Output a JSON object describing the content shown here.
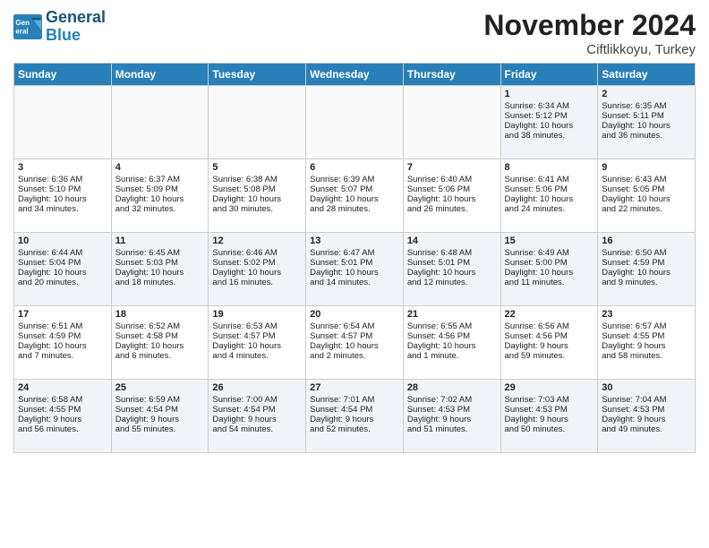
{
  "logo": {
    "line1": "General",
    "line2": "Blue"
  },
  "title": "November 2024",
  "location": "Ciftlikkoyu, Turkey",
  "headers": [
    "Sunday",
    "Monday",
    "Tuesday",
    "Wednesday",
    "Thursday",
    "Friday",
    "Saturday"
  ],
  "weeks": [
    [
      {
        "day": "",
        "content": ""
      },
      {
        "day": "",
        "content": ""
      },
      {
        "day": "",
        "content": ""
      },
      {
        "day": "",
        "content": ""
      },
      {
        "day": "",
        "content": ""
      },
      {
        "day": "1",
        "content": "Sunrise: 6:34 AM\nSunset: 5:12 PM\nDaylight: 10 hours\nand 38 minutes."
      },
      {
        "day": "2",
        "content": "Sunrise: 6:35 AM\nSunset: 5:11 PM\nDaylight: 10 hours\nand 36 minutes."
      }
    ],
    [
      {
        "day": "3",
        "content": "Sunrise: 6:36 AM\nSunset: 5:10 PM\nDaylight: 10 hours\nand 34 minutes."
      },
      {
        "day": "4",
        "content": "Sunrise: 6:37 AM\nSunset: 5:09 PM\nDaylight: 10 hours\nand 32 minutes."
      },
      {
        "day": "5",
        "content": "Sunrise: 6:38 AM\nSunset: 5:08 PM\nDaylight: 10 hours\nand 30 minutes."
      },
      {
        "day": "6",
        "content": "Sunrise: 6:39 AM\nSunset: 5:07 PM\nDaylight: 10 hours\nand 28 minutes."
      },
      {
        "day": "7",
        "content": "Sunrise: 6:40 AM\nSunset: 5:06 PM\nDaylight: 10 hours\nand 26 minutes."
      },
      {
        "day": "8",
        "content": "Sunrise: 6:41 AM\nSunset: 5:06 PM\nDaylight: 10 hours\nand 24 minutes."
      },
      {
        "day": "9",
        "content": "Sunrise: 6:43 AM\nSunset: 5:05 PM\nDaylight: 10 hours\nand 22 minutes."
      }
    ],
    [
      {
        "day": "10",
        "content": "Sunrise: 6:44 AM\nSunset: 5:04 PM\nDaylight: 10 hours\nand 20 minutes."
      },
      {
        "day": "11",
        "content": "Sunrise: 6:45 AM\nSunset: 5:03 PM\nDaylight: 10 hours\nand 18 minutes."
      },
      {
        "day": "12",
        "content": "Sunrise: 6:46 AM\nSunset: 5:02 PM\nDaylight: 10 hours\nand 16 minutes."
      },
      {
        "day": "13",
        "content": "Sunrise: 6:47 AM\nSunset: 5:01 PM\nDaylight: 10 hours\nand 14 minutes."
      },
      {
        "day": "14",
        "content": "Sunrise: 6:48 AM\nSunset: 5:01 PM\nDaylight: 10 hours\nand 12 minutes."
      },
      {
        "day": "15",
        "content": "Sunrise: 6:49 AM\nSunset: 5:00 PM\nDaylight: 10 hours\nand 11 minutes."
      },
      {
        "day": "16",
        "content": "Sunrise: 6:50 AM\nSunset: 4:59 PM\nDaylight: 10 hours\nand 9 minutes."
      }
    ],
    [
      {
        "day": "17",
        "content": "Sunrise: 6:51 AM\nSunset: 4:59 PM\nDaylight: 10 hours\nand 7 minutes."
      },
      {
        "day": "18",
        "content": "Sunrise: 6:52 AM\nSunset: 4:58 PM\nDaylight: 10 hours\nand 6 minutes."
      },
      {
        "day": "19",
        "content": "Sunrise: 6:53 AM\nSunset: 4:57 PM\nDaylight: 10 hours\nand 4 minutes."
      },
      {
        "day": "20",
        "content": "Sunrise: 6:54 AM\nSunset: 4:57 PM\nDaylight: 10 hours\nand 2 minutes."
      },
      {
        "day": "21",
        "content": "Sunrise: 6:55 AM\nSunset: 4:56 PM\nDaylight: 10 hours\nand 1 minute."
      },
      {
        "day": "22",
        "content": "Sunrise: 6:56 AM\nSunset: 4:56 PM\nDaylight: 9 hours\nand 59 minutes."
      },
      {
        "day": "23",
        "content": "Sunrise: 6:57 AM\nSunset: 4:55 PM\nDaylight: 9 hours\nand 58 minutes."
      }
    ],
    [
      {
        "day": "24",
        "content": "Sunrise: 6:58 AM\nSunset: 4:55 PM\nDaylight: 9 hours\nand 56 minutes."
      },
      {
        "day": "25",
        "content": "Sunrise: 6:59 AM\nSunset: 4:54 PM\nDaylight: 9 hours\nand 55 minutes."
      },
      {
        "day": "26",
        "content": "Sunrise: 7:00 AM\nSunset: 4:54 PM\nDaylight: 9 hours\nand 54 minutes."
      },
      {
        "day": "27",
        "content": "Sunrise: 7:01 AM\nSunset: 4:54 PM\nDaylight: 9 hours\nand 52 minutes."
      },
      {
        "day": "28",
        "content": "Sunrise: 7:02 AM\nSunset: 4:53 PM\nDaylight: 9 hours\nand 51 minutes."
      },
      {
        "day": "29",
        "content": "Sunrise: 7:03 AM\nSunset: 4:53 PM\nDaylight: 9 hours\nand 50 minutes."
      },
      {
        "day": "30",
        "content": "Sunrise: 7:04 AM\nSunset: 4:53 PM\nDaylight: 9 hours\nand 49 minutes."
      }
    ]
  ]
}
